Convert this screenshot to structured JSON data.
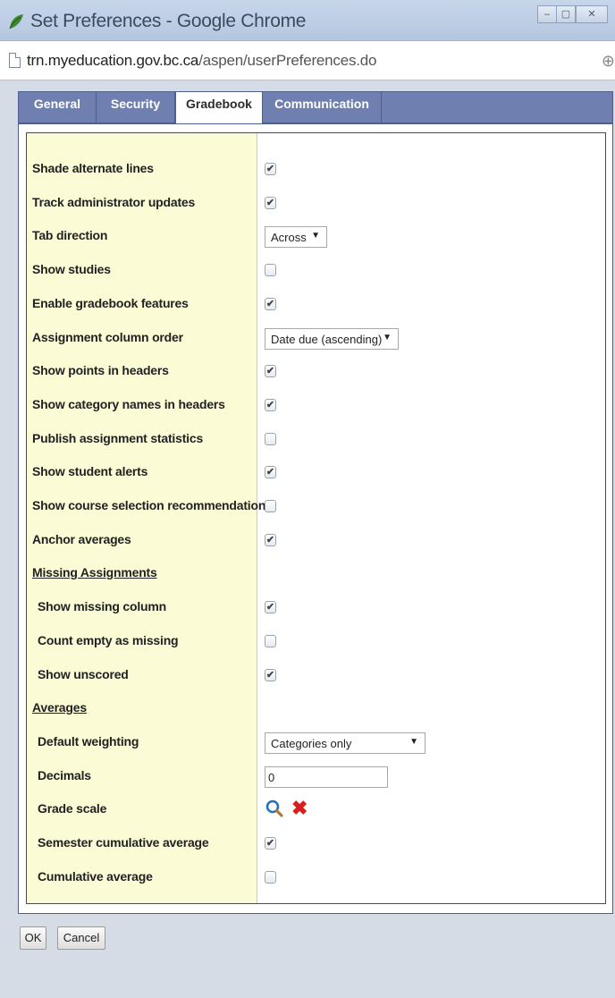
{
  "window": {
    "title": "Set Preferences - Google Chrome",
    "controls": [
      "–",
      "▢",
      "✕"
    ]
  },
  "address": {
    "host": "trn.myeducation.gov.bc.ca",
    "path": "/aspen/userPreferences.do"
  },
  "tabs": [
    {
      "label": "General",
      "active": false
    },
    {
      "label": "Security",
      "active": false
    },
    {
      "label": "Gradebook",
      "active": true
    },
    {
      "label": "Communication",
      "active": false
    }
  ],
  "rows": [
    {
      "label": "Shade alternate lines",
      "type": "checkbox",
      "checked": true
    },
    {
      "label": "Track administrator updates",
      "type": "checkbox",
      "checked": true
    },
    {
      "label": "Tab direction",
      "type": "select",
      "value": "Across"
    },
    {
      "label": "Show studies",
      "type": "checkbox",
      "checked": false
    },
    {
      "label": "Enable gradebook features",
      "type": "checkbox",
      "checked": true
    },
    {
      "label": "Assignment column order",
      "type": "select",
      "value": "Date due (ascending)"
    },
    {
      "label": "Show points in headers",
      "type": "checkbox",
      "checked": true
    },
    {
      "label": "Show category names in headers",
      "type": "checkbox",
      "checked": true
    },
    {
      "label": "Publish assignment statistics",
      "type": "checkbox",
      "checked": false
    },
    {
      "label": "Show student alerts",
      "type": "checkbox",
      "checked": true
    },
    {
      "label": "Show course selection recommendation",
      "type": "checkbox",
      "checked": false
    },
    {
      "label": "Anchor averages",
      "type": "checkbox",
      "checked": true
    },
    {
      "label": "Missing Assignments",
      "type": "section"
    },
    {
      "label": "Show missing column",
      "type": "checkbox",
      "checked": true
    },
    {
      "label": "Count empty as missing",
      "type": "checkbox",
      "checked": false
    },
    {
      "label": "Show unscored",
      "type": "checkbox",
      "checked": true
    },
    {
      "label": "Averages",
      "type": "section"
    },
    {
      "label": "Default weighting",
      "type": "select",
      "value": "Categories only"
    },
    {
      "label": "Decimals",
      "type": "text",
      "value": "0"
    },
    {
      "label": "Grade scale",
      "type": "lookup"
    },
    {
      "label": "Semester cumulative average",
      "type": "checkbox",
      "checked": true
    },
    {
      "label": "Cumulative average",
      "type": "checkbox",
      "checked": false
    }
  ],
  "buttons": {
    "ok": "OK",
    "cancel": "Cancel"
  },
  "colors": {
    "tab_bar": "#6f7fb0",
    "label_column": "#fbfbd6",
    "clear_icon": "#d62020",
    "search_icon": "#2a6fb8"
  },
  "icons": {
    "grade_scale_lookup": "search-icon",
    "grade_scale_clear": "delete-x-icon"
  }
}
